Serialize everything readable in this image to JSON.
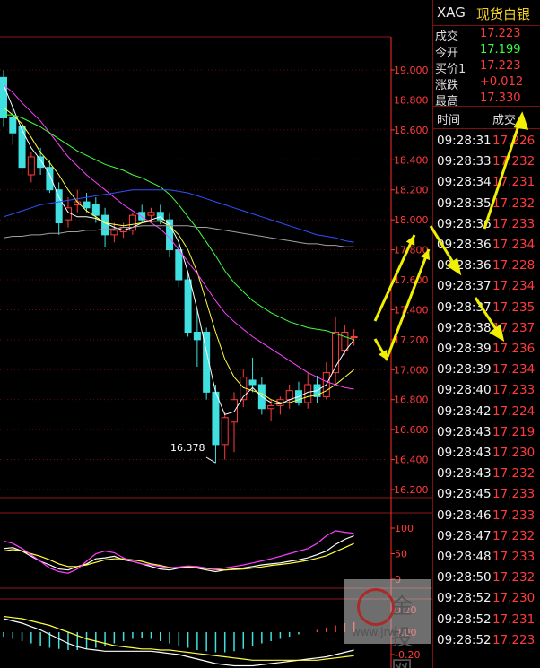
{
  "header": {
    "symbol": "XAG",
    "name": "现货白银"
  },
  "quote": [
    {
      "label": "成交",
      "value": "17.223",
      "color": "#ff3b3b"
    },
    {
      "label": "今开",
      "value": "17.199",
      "color": "#3bff3b"
    },
    {
      "label": "买价1",
      "value": "17.223",
      "color": "#ff3b3b"
    },
    {
      "label": "涨跌",
      "value": "+0.012",
      "color": "#ff3b3b"
    },
    {
      "label": "最高",
      "value": "17.330",
      "color": "#ff3b3b"
    }
  ],
  "ticks_header": {
    "time": "时间",
    "price": "成交"
  },
  "ticks": [
    {
      "time": "09:28:31",
      "price": "17.226"
    },
    {
      "time": "09:28:33",
      "price": "17.232"
    },
    {
      "time": "09:28:34",
      "price": "17.231"
    },
    {
      "time": "09:28:35",
      "price": "17.232"
    },
    {
      "time": "09:28:36",
      "price": "17.233"
    },
    {
      "time": "09:28:36",
      "price": "17.234"
    },
    {
      "time": "09:28:36",
      "price": "17.228"
    },
    {
      "time": "09:28:37",
      "price": "17.234"
    },
    {
      "time": "09:28:37",
      "price": "17.235"
    },
    {
      "time": "09:28:38",
      "price": "17.237"
    },
    {
      "time": "09:28:39",
      "price": "17.236"
    },
    {
      "time": "09:28:39",
      "price": "17.234"
    },
    {
      "time": "09:28:40",
      "price": "17.233"
    },
    {
      "time": "09:28:42",
      "price": "17.224"
    },
    {
      "time": "09:28:43",
      "price": "17.219"
    },
    {
      "time": "09:28:43",
      "price": "17.230"
    },
    {
      "time": "09:28:43",
      "price": "17.232"
    },
    {
      "time": "09:28:45",
      "price": "17.233"
    },
    {
      "time": "09:28:46",
      "price": "17.233"
    },
    {
      "time": "09:28:47",
      "price": "17.232"
    },
    {
      "time": "09:28:48",
      "price": "17.233"
    },
    {
      "time": "09:28:50",
      "price": "17.232"
    },
    {
      "time": "09:28:52",
      "price": "17.230"
    },
    {
      "time": "09:28:52",
      "price": "17.231"
    },
    {
      "time": "09:28:52",
      "price": "17.223"
    }
  ],
  "watermark": {
    "brand": "金投网",
    "url": "www.jrw..."
  },
  "chart_data": [
    {
      "type": "candlestick",
      "ylim": [
        16.2,
        19.1
      ],
      "y_ticks": [
        "19.000",
        "18.800",
        "18.600",
        "18.400",
        "18.200",
        "18.000",
        "17.800",
        "17.600",
        "17.400",
        "17.200",
        "17.000",
        "16.800",
        "16.600",
        "16.400",
        "16.200"
      ],
      "annotation": "16.378",
      "colors": {
        "up": "#ff3b3b",
        "down": "#40e0e0",
        "grid": "#8a1a1a",
        "axis": "#ff3b3b"
      },
      "candles": [
        {
          "o": 18.95,
          "h": 19.0,
          "l": 18.62,
          "c": 18.68
        },
        {
          "o": 18.68,
          "h": 18.75,
          "l": 18.5,
          "c": 18.58
        },
        {
          "o": 18.62,
          "h": 18.7,
          "l": 18.3,
          "c": 18.35
        },
        {
          "o": 18.3,
          "h": 18.45,
          "l": 18.25,
          "c": 18.42
        },
        {
          "o": 18.42,
          "h": 18.48,
          "l": 18.3,
          "c": 18.35
        },
        {
          "o": 18.35,
          "h": 18.4,
          "l": 18.18,
          "c": 18.2
        },
        {
          "o": 18.2,
          "h": 18.25,
          "l": 17.9,
          "c": 17.98
        },
        {
          "o": 18.0,
          "h": 18.15,
          "l": 17.95,
          "c": 18.08
        },
        {
          "o": 18.1,
          "h": 18.2,
          "l": 18.05,
          "c": 18.12
        },
        {
          "o": 18.12,
          "h": 18.18,
          "l": 18.05,
          "c": 18.08
        },
        {
          "o": 18.1,
          "h": 18.15,
          "l": 17.98,
          "c": 18.03
        },
        {
          "o": 18.03,
          "h": 18.08,
          "l": 17.82,
          "c": 17.9
        },
        {
          "o": 17.9,
          "h": 17.98,
          "l": 17.85,
          "c": 17.93
        },
        {
          "o": 17.92,
          "h": 17.98,
          "l": 17.88,
          "c": 17.95
        },
        {
          "o": 17.93,
          "h": 18.05,
          "l": 17.9,
          "c": 18.03
        },
        {
          "o": 18.05,
          "h": 18.1,
          "l": 17.98,
          "c": 18.0
        },
        {
          "o": 18.03,
          "h": 18.08,
          "l": 17.98,
          "c": 18.05
        },
        {
          "o": 18.05,
          "h": 18.1,
          "l": 17.97,
          "c": 18.0
        },
        {
          "o": 18.0,
          "h": 18.05,
          "l": 17.75,
          "c": 17.8
        },
        {
          "o": 17.8,
          "h": 17.85,
          "l": 17.55,
          "c": 17.6
        },
        {
          "o": 17.6,
          "h": 17.65,
          "l": 17.22,
          "c": 17.25
        },
        {
          "o": 17.25,
          "h": 17.4,
          "l": 17.02,
          "c": 17.2
        },
        {
          "o": 17.25,
          "h": 17.28,
          "l": 16.8,
          "c": 16.85
        },
        {
          "o": 16.85,
          "h": 16.9,
          "l": 16.38,
          "c": 16.5
        },
        {
          "o": 16.5,
          "h": 16.72,
          "l": 16.4,
          "c": 16.68
        },
        {
          "o": 16.65,
          "h": 16.85,
          "l": 16.45,
          "c": 16.8
        },
        {
          "o": 16.8,
          "h": 17.0,
          "l": 16.75,
          "c": 16.95
        },
        {
          "o": 16.93,
          "h": 17.08,
          "l": 16.85,
          "c": 16.9
        },
        {
          "o": 16.9,
          "h": 16.95,
          "l": 16.7,
          "c": 16.74
        },
        {
          "o": 16.74,
          "h": 16.8,
          "l": 16.66,
          "c": 16.76
        },
        {
          "o": 16.76,
          "h": 16.82,
          "l": 16.7,
          "c": 16.8
        },
        {
          "o": 16.8,
          "h": 16.9,
          "l": 16.74,
          "c": 16.86
        },
        {
          "o": 16.86,
          "h": 16.92,
          "l": 16.76,
          "c": 16.78
        },
        {
          "o": 16.78,
          "h": 16.98,
          "l": 16.74,
          "c": 16.9
        },
        {
          "o": 16.9,
          "h": 16.96,
          "l": 16.78,
          "c": 16.82
        },
        {
          "o": 16.82,
          "h": 17.05,
          "l": 16.8,
          "c": 16.98
        },
        {
          "o": 16.98,
          "h": 17.35,
          "l": 16.9,
          "c": 17.25
        },
        {
          "o": 17.13,
          "h": 17.3,
          "l": 17.1,
          "c": 17.25
        },
        {
          "o": 17.22,
          "h": 17.27,
          "l": 17.16,
          "c": 17.22
        }
      ],
      "ma_lines": [
        {
          "color": "#ffffff",
          "values": [
            18.9,
            18.75,
            18.6,
            18.48,
            18.4,
            18.3,
            18.15,
            18.05,
            18.02,
            18.02,
            18.01,
            17.98,
            17.95,
            17.93,
            17.95,
            17.98,
            18.0,
            18.02,
            17.97,
            17.85,
            17.65,
            17.4,
            17.12,
            16.85,
            16.7,
            16.72,
            16.82,
            16.88,
            16.82,
            16.78,
            16.77,
            16.8,
            16.82,
            16.85,
            16.86,
            16.9,
            17.02,
            17.12,
            17.2
          ]
        },
        {
          "color": "#ffff40",
          "values": [
            18.75,
            18.7,
            18.64,
            18.55,
            18.45,
            18.38,
            18.3,
            18.2,
            18.12,
            18.06,
            18.02,
            17.98,
            17.97,
            17.96,
            17.97,
            17.98,
            17.99,
            17.99,
            17.96,
            17.9,
            17.8,
            17.65,
            17.45,
            17.25,
            17.07,
            16.95,
            16.88,
            16.86,
            16.84,
            16.8,
            16.78,
            16.78,
            16.8,
            16.82,
            16.83,
            16.86,
            16.9,
            16.95,
            17.0
          ]
        },
        {
          "color": "#ff40ff",
          "values": [
            18.9,
            18.85,
            18.78,
            18.72,
            18.66,
            18.58,
            18.5,
            18.42,
            18.36,
            18.3,
            18.25,
            18.2,
            18.15,
            18.1,
            18.06,
            18.02,
            17.98,
            17.94,
            17.88,
            17.8,
            17.72,
            17.64,
            17.55,
            17.46,
            17.38,
            17.32,
            17.27,
            17.22,
            17.18,
            17.14,
            17.1,
            17.06,
            17.02,
            16.98,
            16.95,
            16.92,
            16.9,
            16.88,
            16.87
          ]
        },
        {
          "color": "#40ff40",
          "values": [
            18.7,
            18.7,
            18.68,
            18.65,
            18.62,
            18.58,
            18.54,
            18.5,
            18.46,
            18.43,
            18.4,
            18.37,
            18.35,
            18.33,
            18.3,
            18.28,
            18.25,
            18.22,
            18.17,
            18.1,
            18.02,
            17.94,
            17.85,
            17.76,
            17.66,
            17.58,
            17.52,
            17.46,
            17.42,
            17.38,
            17.35,
            17.32,
            17.3,
            17.28,
            17.27,
            17.26,
            17.24,
            17.22,
            17.2
          ]
        },
        {
          "color": "#3050ff",
          "values": [
            18.02,
            18.04,
            18.06,
            18.08,
            18.1,
            18.11,
            18.12,
            18.13,
            18.14,
            18.15,
            18.16,
            18.17,
            18.18,
            18.19,
            18.2,
            18.2,
            18.2,
            18.2,
            18.2,
            18.19,
            18.18,
            18.16,
            18.14,
            18.12,
            18.1,
            18.08,
            18.06,
            18.04,
            18.02,
            18.0,
            17.98,
            17.96,
            17.94,
            17.92,
            17.9,
            17.89,
            17.88,
            17.86,
            17.85
          ]
        },
        {
          "color": "#a0a0a0",
          "values": [
            17.88,
            17.89,
            17.89,
            17.9,
            17.9,
            17.91,
            17.91,
            17.92,
            17.92,
            17.93,
            17.93,
            17.94,
            17.94,
            17.95,
            17.95,
            17.96,
            17.96,
            17.96,
            17.96,
            17.96,
            17.96,
            17.95,
            17.95,
            17.94,
            17.93,
            17.92,
            17.91,
            17.9,
            17.89,
            17.88,
            17.87,
            17.86,
            17.85,
            17.84,
            17.84,
            17.83,
            17.83,
            17.82,
            17.82
          ]
        }
      ]
    },
    {
      "type": "line",
      "ylim": [
        0,
        110
      ],
      "y_ticks": [
        "100",
        "50",
        "0"
      ],
      "series": [
        {
          "color": "#ffffff",
          "values": [
            60,
            62,
            55,
            45,
            35,
            28,
            20,
            18,
            25,
            30,
            40,
            42,
            45,
            38,
            35,
            30,
            25,
            20,
            18,
            22,
            25,
            22,
            18,
            15,
            18,
            20,
            22,
            25,
            28,
            30,
            32,
            35,
            38,
            42,
            48,
            55,
            68,
            78,
            85
          ]
        },
        {
          "color": "#ffff40",
          "values": [
            55,
            58,
            55,
            50,
            45,
            38,
            30,
            25,
            25,
            28,
            33,
            38,
            40,
            40,
            38,
            35,
            30,
            27,
            23,
            22,
            23,
            23,
            21,
            19,
            18,
            19,
            20,
            22,
            24,
            27,
            29,
            31,
            34,
            37,
            41,
            46,
            54,
            62,
            70
          ]
        },
        {
          "color": "#ff40ff",
          "values": [
            75,
            70,
            60,
            48,
            35,
            22,
            15,
            12,
            20,
            35,
            50,
            55,
            52,
            42,
            35,
            30,
            28,
            25,
            22,
            24,
            26,
            25,
            22,
            20,
            22,
            25,
            28,
            32,
            36,
            40,
            45,
            50,
            55,
            60,
            70,
            85,
            95,
            92,
            90
          ]
        }
      ]
    },
    {
      "type": "bar",
      "ylim": [
        -0.3,
        0.3
      ],
      "y_ticks": [
        "0.20",
        "0.00",
        "-0.20"
      ],
      "values": [
        -0.04,
        -0.06,
        -0.08,
        -0.1,
        -0.12,
        -0.14,
        -0.15,
        -0.16,
        -0.16,
        -0.15,
        -0.14,
        -0.12,
        -0.1,
        -0.08,
        -0.06,
        -0.05,
        -0.06,
        -0.08,
        -0.1,
        -0.12,
        -0.14,
        -0.16,
        -0.17,
        -0.18,
        -0.18,
        -0.17,
        -0.15,
        -0.12,
        -0.1,
        -0.08,
        -0.06,
        -0.04,
        -0.02,
        0.0,
        0.02,
        0.04,
        0.06,
        0.08,
        0.09
      ],
      "lines": [
        {
          "color": "#ffffff",
          "values": [
            0.12,
            0.1,
            0.08,
            0.05,
            0.02,
            -0.02,
            -0.06,
            -0.1,
            -0.13,
            -0.15,
            -0.16,
            -0.17,
            -0.17,
            -0.17,
            -0.17,
            -0.17,
            -0.17,
            -0.18,
            -0.19,
            -0.2,
            -0.22,
            -0.24,
            -0.26,
            -0.28,
            -0.29,
            -0.3,
            -0.3,
            -0.3,
            -0.29,
            -0.28,
            -0.27,
            -0.26,
            -0.25,
            -0.24,
            -0.23,
            -0.22,
            -0.2,
            -0.18,
            -0.16
          ]
        },
        {
          "color": "#ffff40",
          "values": [
            0.14,
            0.13,
            0.12,
            0.1,
            0.08,
            0.06,
            0.03,
            0.0,
            -0.03,
            -0.06,
            -0.08,
            -0.1,
            -0.12,
            -0.13,
            -0.14,
            -0.15,
            -0.15,
            -0.16,
            -0.16,
            -0.17,
            -0.18,
            -0.19,
            -0.2,
            -0.21,
            -0.22,
            -0.23,
            -0.24,
            -0.25,
            -0.25,
            -0.25,
            -0.25,
            -0.25,
            -0.25,
            -0.25,
            -0.25,
            -0.24,
            -0.23,
            -0.22,
            -0.21
          ]
        }
      ]
    }
  ]
}
